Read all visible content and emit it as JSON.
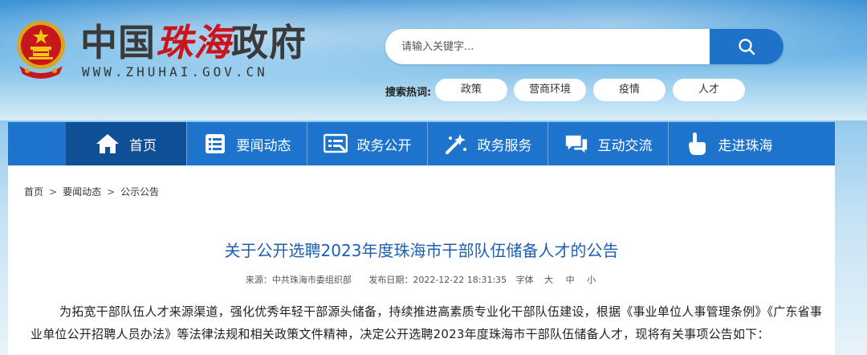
{
  "header": {
    "site_name_part1": "中国",
    "site_name_part2": "珠海",
    "site_name_part3": "政府",
    "site_url": "WWW.ZHUHAI.GOV.CN",
    "search": {
      "placeholder": "请输入关键字..."
    },
    "hot_label": "搜索热词:",
    "hot_tags": [
      "政策",
      "营商环境",
      "疫情",
      "人才"
    ]
  },
  "nav": {
    "items": [
      {
        "label": "首页",
        "icon": "home-icon"
      },
      {
        "label": "要闻动态",
        "icon": "news-list-icon"
      },
      {
        "label": "政务公开",
        "icon": "document-icon"
      },
      {
        "label": "政务服务",
        "icon": "tools-icon"
      },
      {
        "label": "互动交流",
        "icon": "chat-icon"
      },
      {
        "label": "走进珠海",
        "icon": "hand-pointer-icon"
      }
    ]
  },
  "breadcrumb": [
    "首页",
    "要闻动态",
    "公示公告"
  ],
  "article": {
    "title": "关于公开选聘2023年度珠海市干部队伍储备人才的公告",
    "source": "来源：中共珠海市委组织部",
    "published": "发布日期：2022-12-22 18:31:35",
    "font_label": "字体",
    "font_sizes": [
      "大",
      "中",
      "小"
    ],
    "paragraph": "为拓宽干部队伍人才来源渠道，强化优秀年轻干部源头储备，持续推进高素质专业化干部队伍建设，根据《事业单位人事管理条例》《广东省事业单位公开招聘人员办法》等法律法规和相关政策文件精神，决定公开选聘2023年度珠海市干部队伍储备人才，现将有关事项公告如下："
  },
  "colors": {
    "nav_bg": "#1e74cc",
    "nav_active": "#0f4f96",
    "title": "#1f5fb3",
    "brand_red": "#c8161d"
  }
}
